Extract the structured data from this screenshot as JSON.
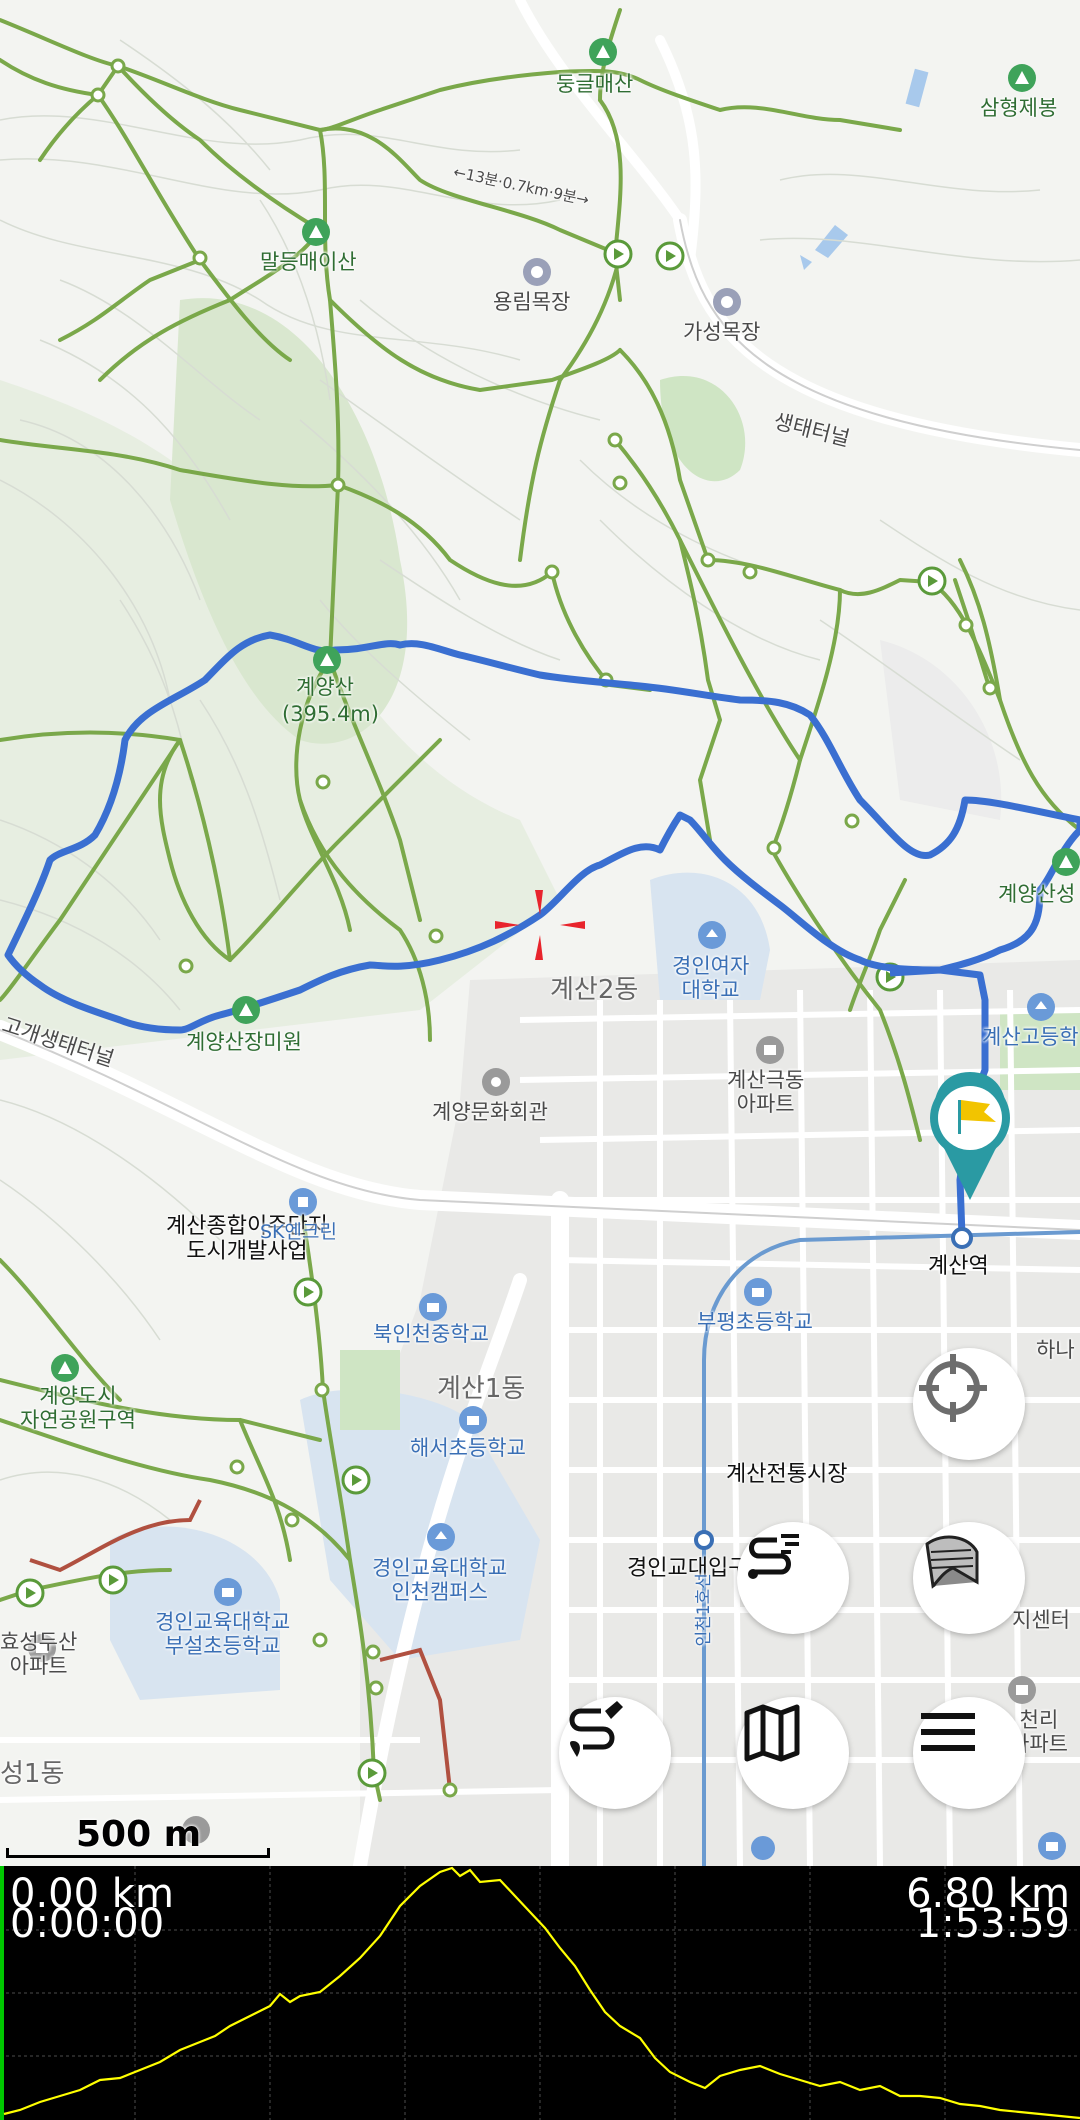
{
  "map": {
    "labels": {
      "dunggeulmaesan": "둥글매산",
      "samhyeongjebong": "삼형제봉",
      "maldeungmaeisan": "말등매이산",
      "yongnimmokjang": "용림목장",
      "gaseongmokjang": "가성목장",
      "saengtae_tunnel": "생태터널",
      "gyeyangsan": "계양산",
      "gyeyangsan_elev": "(395.4m)",
      "gyeyangsanseong": "계양산성",
      "gyeyangsan_jangmiwon": "계양산장미원",
      "gyesan2dong": "계산2동",
      "gyeongin_womens_univ": "경인여자\n대학교",
      "gyeyang_culture_hall": "계양문화회관",
      "gyesan_geukdong_apt": "계산극동\n아파트",
      "gyesan_highschool": "계산고등학",
      "gaesaengtae": "고개생태터널",
      "gyesan_station": "계산역",
      "gyesan_redevelop": "계산종합이주단지\n도시개발사업",
      "sk_energy": "SK엔크린",
      "bugincheon_middle": "북인천중학교",
      "bupyeong_elementary": "부평초등학교",
      "hana": "하나",
      "gyeyang_park": "계양도시\n자연공원구역",
      "gyesan1dong": "계산1동",
      "haeseo_elementary": "해서초등학교",
      "gyesan_market": "계산전통시장",
      "gyeongin_edu_univ": "경인교육대학교\n인천캠퍼스",
      "gyeongin_edu_univ_station": "경인교대입구",
      "gyeongin_edu_elementary": "경인교육대학교\n부설초등학교",
      "hyoseong_apt": "효성두산\n아파트",
      "seong1dong": "성1동",
      "line1": "인천1호선",
      "center": "지센터",
      "cheonri_apt": "천리\n아파트",
      "trail_time": "←13분·0.7km·9분→"
    },
    "scale_label": "500 m",
    "colors": {
      "track": "#3a6fd1",
      "trail": "#7aa84a",
      "crosshair": "#e8242c",
      "finish_pin": "#2a9aa3",
      "profile_line": "#ffff00"
    },
    "buttons": {
      "locate": "crosshair-gps-icon",
      "map_layer": "layers-icon",
      "route_list": "route-list-icon",
      "draw_route": "draw-route-icon",
      "map_select": "map-icon",
      "menu": "menu-icon"
    }
  },
  "profile": {
    "start_distance": "0.00 km",
    "start_time": "0:00:00",
    "end_distance": "6.80 km",
    "end_time": "1:53:59"
  }
}
